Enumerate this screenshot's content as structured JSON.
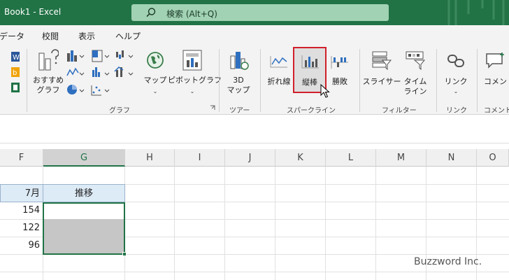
{
  "titlebar": {
    "title": "Book1  -  Excel",
    "search_label": "検索 (Alt+Q)",
    "accent_color": "#217346"
  },
  "tabs": [
    "データ",
    "校閲",
    "表示",
    "ヘルプ"
  ],
  "ribbon": {
    "chart_group": {
      "recommended_line1": "おすすめ",
      "recommended_line2": "グラフ",
      "map_label": "マップ",
      "pivot_label": "ピボットグラフ",
      "group_label": "グラフ"
    },
    "tour_group": {
      "map3d_line1": "3D",
      "map3d_line2": "マップ",
      "group_label": "ツアー"
    },
    "sparkline_group": {
      "line_label": "折れ線",
      "column_label": "縦棒",
      "winloss_label": "勝敗",
      "group_label": "スパークライン"
    },
    "filter_group": {
      "slicer_label": "スライサー",
      "timeline_line1": "タイム",
      "timeline_line2": "ライン",
      "group_label": "フィルター"
    },
    "link_group": {
      "link_label": "リンク",
      "group_label": "リンク"
    },
    "comment_group": {
      "comment_label": "コメント",
      "group_label": "コメント"
    }
  },
  "columns": [
    "F",
    "G",
    "H",
    "I",
    "J",
    "K",
    "L",
    "M",
    "N",
    "O"
  ],
  "sheet": {
    "header_f": "7月",
    "header_g": "推移",
    "values": [
      "154",
      "122",
      "96"
    ]
  },
  "watermark": "Buzzword Inc."
}
